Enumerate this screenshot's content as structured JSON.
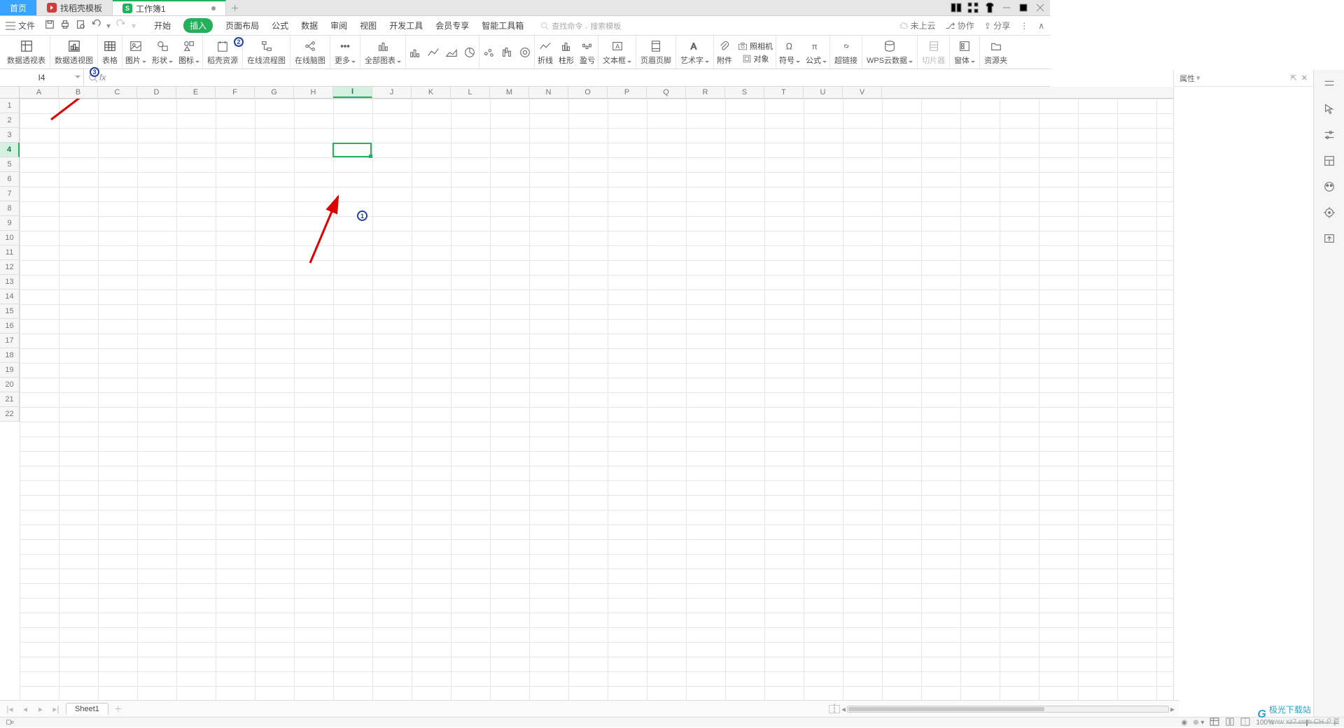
{
  "tabs": {
    "home": "首页",
    "templates": "找稻壳模板",
    "workbook": "工作簿1"
  },
  "file_menu": "文件",
  "menus": [
    "开始",
    "插入",
    "页面布局",
    "公式",
    "数据",
    "审阅",
    "视图",
    "开发工具",
    "会员专享",
    "智能工具箱"
  ],
  "active_menu_index": 1,
  "search_placeholder1": "查找命令",
  "search_placeholder2": "搜索模板",
  "cloud": {
    "not_uploaded": "未上云",
    "coop": "协作",
    "share": "分享"
  },
  "ribbon": {
    "pivot_table": "数据透视表",
    "pivot_chart": "数据透视图",
    "table": "表格",
    "picture": "图片",
    "shapes": "形状",
    "icons": "图标",
    "docer": "稻壳资源",
    "flow": "在线流程图",
    "mindmap": "在线脑图",
    "more": "更多",
    "all_charts": "全部图表",
    "sparkline_line": "折线",
    "sparkline_col": "柱形",
    "sparkline_wl": "盈亏",
    "textbox": "文本框",
    "header_footer": "页眉页脚",
    "wordart": "艺术字",
    "attachment": "附件",
    "camera": "照相机",
    "object": "对象",
    "symbol": "符号",
    "equation": "公式",
    "hyperlink": "超链接",
    "wps_cloud": "WPS云数据",
    "slicer": "切片器",
    "forms": "窗体",
    "resources": "资源夹"
  },
  "namebox": "I4",
  "columns": [
    "A",
    "B",
    "C",
    "D",
    "E",
    "F",
    "G",
    "H",
    "I",
    "J",
    "K",
    "L",
    "M",
    "N",
    "O",
    "P",
    "Q",
    "R",
    "S",
    "T",
    "U",
    "V"
  ],
  "active_col": 8,
  "rows": [
    1,
    2,
    3,
    4,
    5,
    6,
    7,
    8,
    9,
    10,
    11,
    12,
    13,
    14,
    15,
    16,
    17,
    18,
    19,
    20,
    21,
    22
  ],
  "active_row": 3,
  "properties_title": "属性",
  "sheet_name": "Sheet1",
  "zoom": "100%",
  "status_ime": "CH 众首",
  "markers": {
    "one": "1",
    "two": "2",
    "three": "3"
  },
  "watermark": {
    "brand": "极光下载站",
    "url": "www.xz7.com"
  }
}
